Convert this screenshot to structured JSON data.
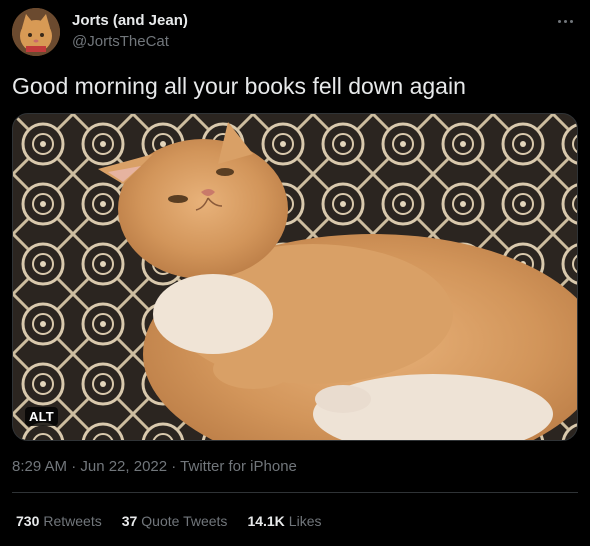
{
  "author": {
    "display_name": "Jorts (and Jean)",
    "handle": "@JortsTheCat",
    "avatar_icon": "cat-avatar"
  },
  "more_icon": "more-options-icon",
  "tweet": {
    "text": "Good morning all your books fell down again",
    "media_alt_badge": "ALT",
    "meta": "8:29 AM · Jun 22, 2022 · Twitter for iPhone"
  },
  "stats": [
    {
      "count": "730",
      "label": "Retweets"
    },
    {
      "count": "37",
      "label": "Quote Tweets"
    },
    {
      "count": "14.1K",
      "label": "Likes"
    }
  ],
  "colors": {
    "background": "#000000",
    "text_primary": "#e7e9ea",
    "text_secondary": "#71767b",
    "divider": "#2f3336"
  }
}
